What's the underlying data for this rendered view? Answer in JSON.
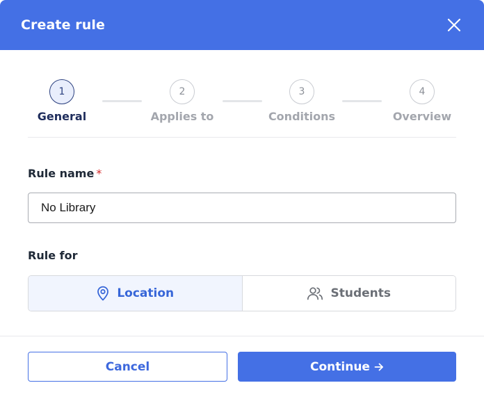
{
  "dialog": {
    "title": "Create rule",
    "close_icon": "close-icon"
  },
  "stepper": {
    "active_step": 1,
    "steps": [
      {
        "number": "1",
        "label": "General"
      },
      {
        "number": "2",
        "label": "Applies to"
      },
      {
        "number": "3",
        "label": "Conditions"
      },
      {
        "number": "4",
        "label": "Overview"
      }
    ]
  },
  "rule_name": {
    "label": "Rule name",
    "required_mark": "*",
    "value": "No Library"
  },
  "rule_for": {
    "label": "Rule for",
    "selected": "Location",
    "options": [
      {
        "label": "Location",
        "icon": "map-pin-icon"
      },
      {
        "label": "Students",
        "icon": "users-icon"
      }
    ]
  },
  "footer": {
    "cancel_label": "Cancel",
    "continue_label": "Continue",
    "continue_icon": "arrow-right-icon"
  },
  "colors": {
    "accent": "#4470e5",
    "active_step": "#2a3f7e",
    "required": "#d52b2b"
  }
}
